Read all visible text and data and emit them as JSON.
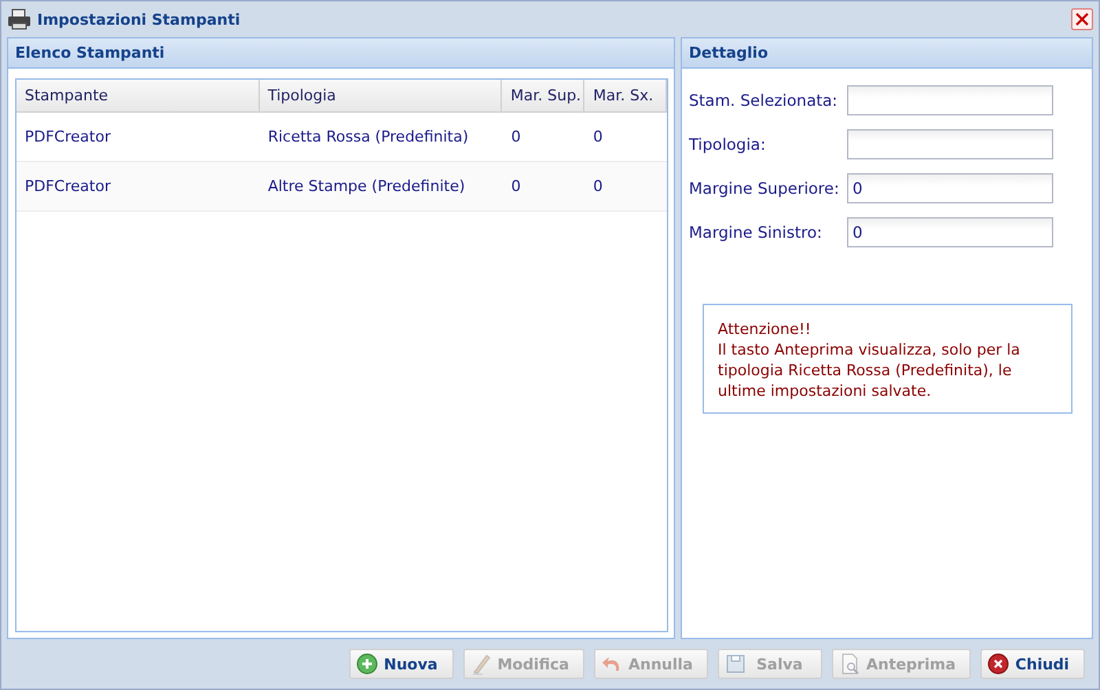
{
  "window": {
    "title": "Impostazioni Stampanti"
  },
  "list_panel": {
    "title": "Elenco Stampanti",
    "table": {
      "columns": [
        "Stampante",
        "Tipologia",
        "Mar. Sup.",
        "Mar. Sx."
      ],
      "rows": [
        {
          "cells": [
            "PDFCreator",
            "Ricetta Rossa (Predefinita)",
            "0",
            "0"
          ],
          "selected": false
        },
        {
          "cells": [
            "PDFCreator",
            "Altre Stampe (Predefinite)",
            "0",
            "0"
          ],
          "selected": false
        }
      ]
    }
  },
  "detail_panel": {
    "title": "Dettaglio",
    "fields": [
      {
        "label": "Stam. Selezionata:"
      },
      {
        "label": "Tipologia:"
      },
      {
        "label": "Margine Superiore:",
        "value": "0"
      },
      {
        "label": "Margine Sinistro:",
        "value": "0"
      }
    ],
    "notice": {
      "heading": "Attenzione!!",
      "text": "Il tasto Anteprima visualizza, solo per la tipologia Ricetta Rossa (Predefinita), le ultime impostazioni salvate."
    }
  },
  "buttons": [
    {
      "label": "Nuova",
      "disabled": false
    },
    {
      "label": "Modifica",
      "disabled": true
    },
    {
      "label": "Annulla",
      "disabled": true
    },
    {
      "label": "Salva",
      "disabled": true
    },
    {
      "label": "Anteprima",
      "disabled": true
    },
    {
      "label": "Chiudi",
      "disabled": false
    }
  ]
}
